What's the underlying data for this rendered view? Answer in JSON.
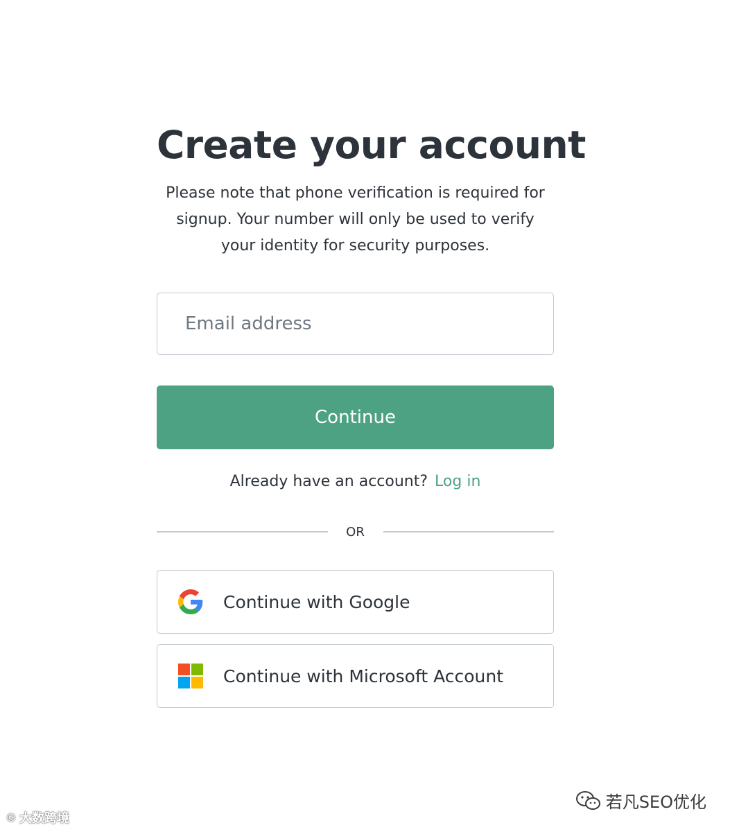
{
  "page": {
    "title": "Create your account",
    "subtitle": "Please note that phone verification is required for signup. Your number will only be used to verify your identity for security purposes."
  },
  "email": {
    "placeholder": "Email address",
    "value": ""
  },
  "continue_button": {
    "label": "Continue"
  },
  "login": {
    "prompt": "Already have an account?",
    "link_label": "Log in"
  },
  "divider": {
    "label": "OR"
  },
  "social": [
    {
      "label": "Continue with Google",
      "icon": "google-logo-icon"
    },
    {
      "label": "Continue with Microsoft Account",
      "icon": "microsoft-logo-icon"
    }
  ],
  "watermarks": {
    "right": "若凡SEO优化",
    "left": "大数跨境"
  },
  "colors": {
    "accent": "#4da283",
    "text": "#2d333a",
    "border": "#c2c8d0",
    "placeholder": "#6f7780"
  }
}
